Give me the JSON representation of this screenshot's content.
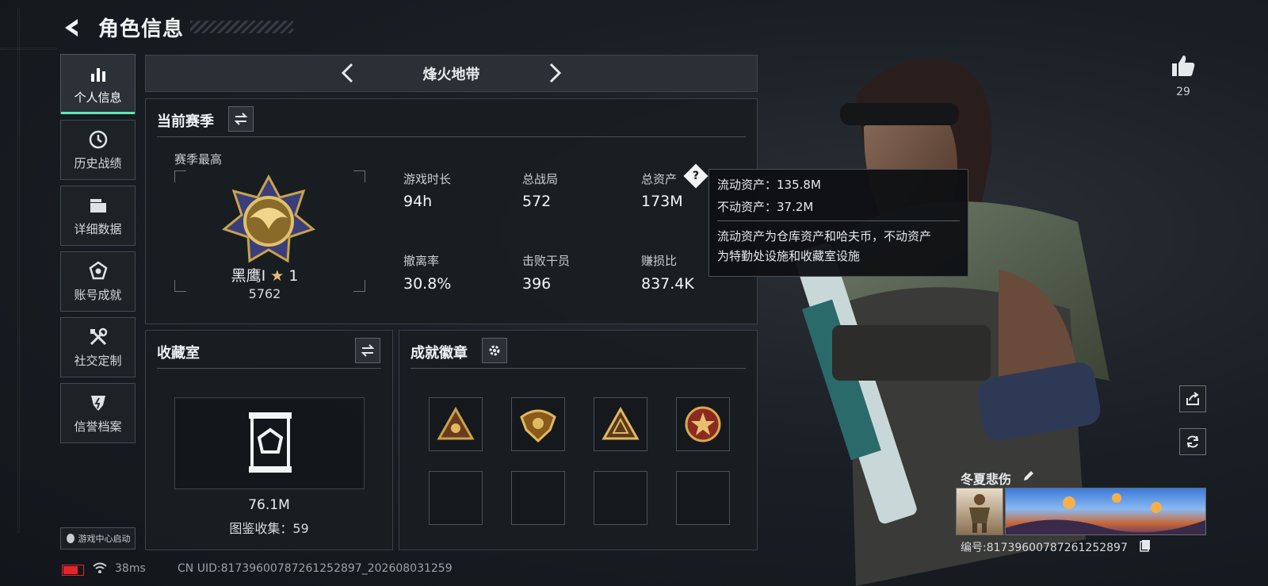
{
  "header": {
    "title": "角色信息"
  },
  "sidebar": {
    "items": [
      {
        "label": "个人信息",
        "icon": "bar-chart-icon"
      },
      {
        "label": "历史战绩",
        "icon": "clock-icon"
      },
      {
        "label": "详细数据",
        "icon": "folder-icon"
      },
      {
        "label": "账号成就",
        "icon": "achievement-icon"
      },
      {
        "label": "社交定制",
        "icon": "tools-icon"
      },
      {
        "label": "信誉档案",
        "icon": "shield-icon"
      }
    ]
  },
  "mode": {
    "title": "烽火地带"
  },
  "season": {
    "section_title": "当前赛季",
    "best_label": "赛季最高",
    "rank_name": "黑鹰I",
    "rank_stars": "1",
    "rank_score": "5762",
    "stats": [
      {
        "label": "游戏时长",
        "value": "94h"
      },
      {
        "label": "总战局",
        "value": "572"
      },
      {
        "label": "总资产",
        "value": "173M"
      },
      {
        "label": "撤离率",
        "value": "30.8%"
      },
      {
        "label": "击败干员",
        "value": "396"
      },
      {
        "label": "赚损比",
        "value": "837.4K"
      }
    ]
  },
  "tooltip": {
    "line1": "流动资产：135.8M",
    "line2": "不动资产：37.2M",
    "desc1": "流动资产为仓库资产和哈夫币，不动资产",
    "desc2": "为特勤处设施和收藏室设施"
  },
  "collection": {
    "section_title": "收藏室",
    "value": "76.1M",
    "count_text": "图鉴收集：59"
  },
  "badges": {
    "section_title": "成就徽章"
  },
  "likes": {
    "count": "29"
  },
  "player": {
    "name": "冬夏悲伤",
    "id_text": "编号:817396007872612528​97"
  },
  "footer": {
    "launcher": "游戏中心启动",
    "ping": "38ms",
    "uid": "CN UID:8173960078726125289​7_202608031259"
  },
  "colors": {
    "accent": "#5ee8b0",
    "gold": "#c9a24a",
    "battery": "#e0262b"
  }
}
